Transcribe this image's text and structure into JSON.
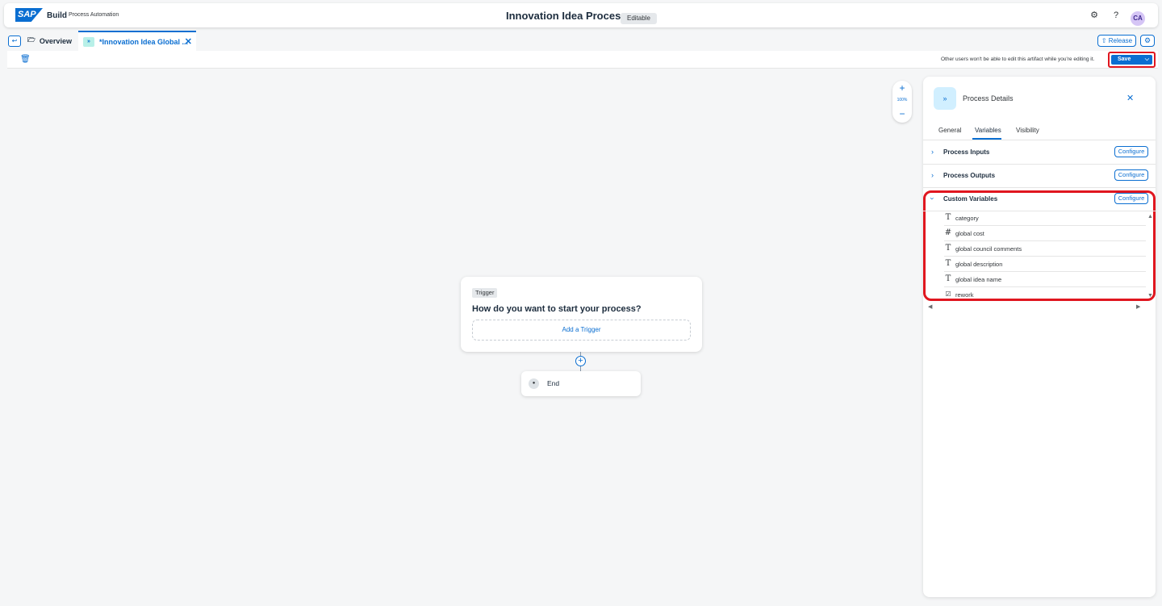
{
  "shell": {
    "logo": "SAP",
    "brand": "Build",
    "product": "Process Automation",
    "title": "Innovation Idea Process",
    "status": "Editable",
    "avatar": "CA"
  },
  "tabs": {
    "overview": "Overview",
    "active": "*Innovation Idea Global ...",
    "release": "Release"
  },
  "toolbar": {
    "note": "Other users won't be able to edit this artifact while you're editing it.",
    "save": "Save"
  },
  "zoom": {
    "level": "100%"
  },
  "canvas": {
    "trigger_tag": "Trigger",
    "trigger_question": "How do you want to start your process?",
    "add_trigger": "Add a Trigger",
    "end_label": "End"
  },
  "panel": {
    "title": "Process Details",
    "tabs": [
      "General",
      "Variables",
      "Visibility"
    ],
    "sections": {
      "inputs": "Process Inputs",
      "outputs": "Process Outputs",
      "custom": "Custom Variables",
      "configure": "Configure"
    },
    "variables": [
      {
        "type_icon": "T",
        "name": "category"
      },
      {
        "type_icon": "#",
        "name": "global cost"
      },
      {
        "type_icon": "T",
        "name": "global council comments"
      },
      {
        "type_icon": "T",
        "name": "global description"
      },
      {
        "type_icon": "T",
        "name": "global idea name"
      },
      {
        "type_icon": "☑",
        "name": "rework"
      }
    ]
  },
  "colors": {
    "accent": "#0a6ed1",
    "highlight": "#e0161f"
  }
}
